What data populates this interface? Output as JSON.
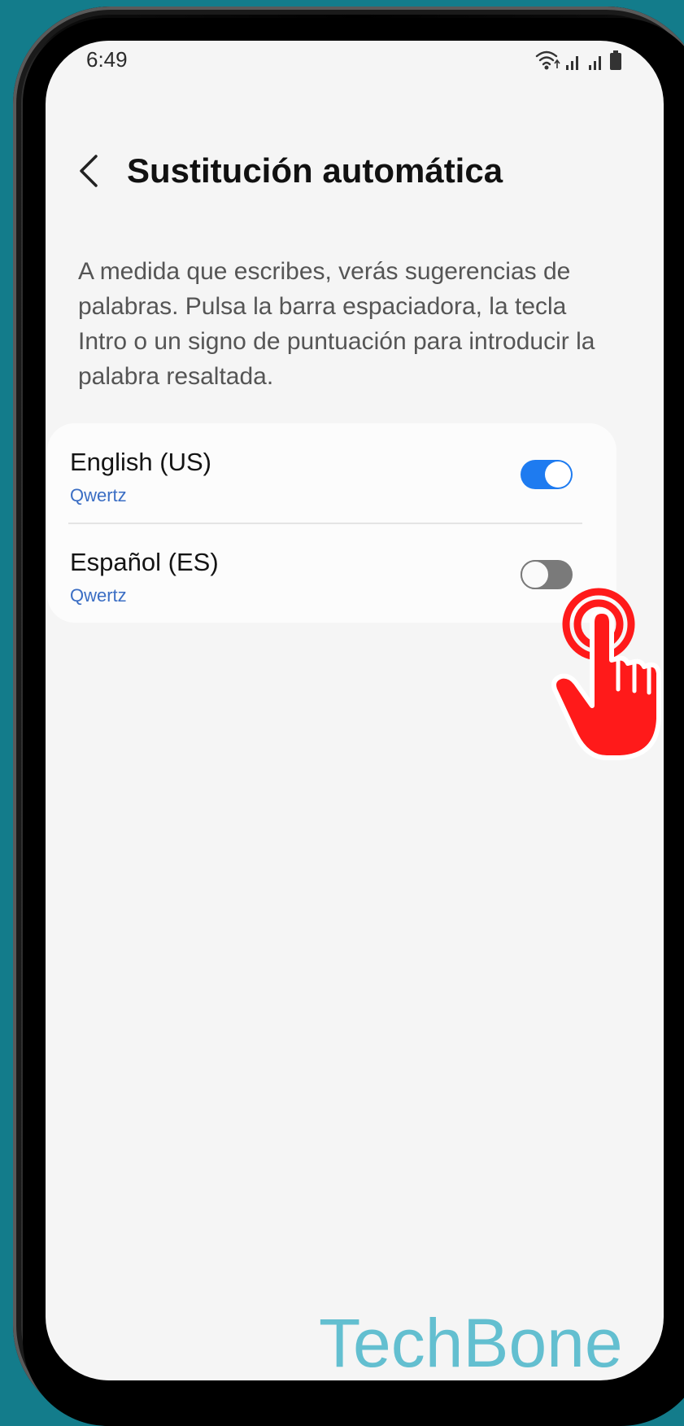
{
  "status_bar": {
    "time": "6:49"
  },
  "header": {
    "title": "Sustitución automática",
    "back_icon": "chevron-left-icon"
  },
  "description": "A medida que escribes, verás sugerencias de palabras. Pulsa la barra espaciadora, la tecla Intro o un signo de puntuación para introducir la palabra resaltada.",
  "languages": [
    {
      "name": "English (US)",
      "layout": "Qwertz",
      "enabled": true
    },
    {
      "name": "Español (ES)",
      "layout": "Qwertz",
      "enabled": false
    }
  ],
  "watermark": "TechBone",
  "colors": {
    "background": "#137c8b",
    "screen": "#f5f5f5",
    "toggle_on": "#1e7bf0",
    "toggle_off": "#7a7a7a",
    "subtitle": "#3b6ec4",
    "tap_indicator": "#ff1a1a"
  }
}
